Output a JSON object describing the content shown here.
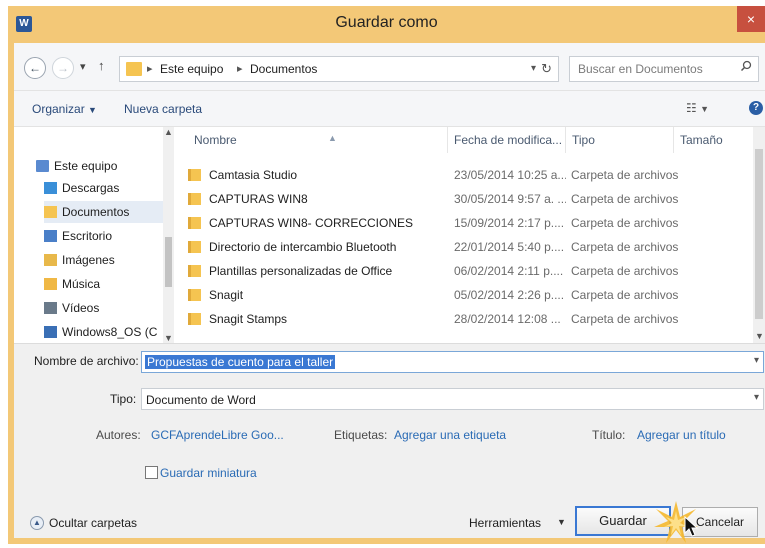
{
  "window": {
    "title": "Guardar como",
    "app_icon_glyph": "W",
    "close_glyph": "×",
    "accent": "#f3c877"
  },
  "address": {
    "back_icon": "back-arrow-icon",
    "forward_icon": "forward-arrow-icon",
    "breadcrumbs": [
      "Este equipo",
      "Documentos"
    ],
    "search_placeholder": "Buscar en Documentos"
  },
  "toolbar": {
    "organize": "Organizar",
    "new_folder": "Nueva carpeta"
  },
  "nav": {
    "root": "Este equipo",
    "items": [
      "Descargas",
      "Documentos",
      "Escritorio",
      "Imágenes",
      "Música",
      "Vídeos",
      "Windows8_OS (C"
    ],
    "selected": "Documentos"
  },
  "columns": {
    "name": "Nombre",
    "date": "Fecha de modifica...",
    "type": "Tipo",
    "size": "Tamaño"
  },
  "files": [
    {
      "name": "Camtasia Studio",
      "date": "23/05/2014 10:25 a...",
      "type": "Carpeta de archivos"
    },
    {
      "name": "CAPTURAS WIN8",
      "date": "30/05/2014 9:57 a. ...",
      "type": "Carpeta de archivos"
    },
    {
      "name": "CAPTURAS WIN8- CORRECCIONES",
      "date": "15/09/2014 2:17 p....",
      "type": "Carpeta de archivos"
    },
    {
      "name": "Directorio de intercambio Bluetooth",
      "date": "22/01/2014 5:40 p....",
      "type": "Carpeta de archivos"
    },
    {
      "name": "Plantillas personalizadas de Office",
      "date": "06/02/2014 2:11 p....",
      "type": "Carpeta de archivos"
    },
    {
      "name": "Snagit",
      "date": "05/02/2014 2:26 p....",
      "type": "Carpeta de archivos"
    },
    {
      "name": "Snagit Stamps",
      "date": "28/02/2014 12:08 ...",
      "type": "Carpeta de archivos"
    }
  ],
  "form": {
    "filename_label": "Nombre de archivo:",
    "filename_value": "Propuestas de cuento para el taller",
    "type_label": "Tipo:",
    "type_value": "Documento de Word",
    "authors_label": "Autores:",
    "authors_value": "GCFAprendeLibre Goo...",
    "tags_label": "Etiquetas:",
    "tags_value": "Agregar una etiqueta",
    "title_label": "Título:",
    "title_value": "Agregar un título",
    "thumbnail_label": "Guardar miniatura"
  },
  "footer": {
    "hide_folders": "Ocultar carpetas",
    "tools": "Herramientas",
    "save": "Guardar",
    "cancel": "Cancelar"
  }
}
